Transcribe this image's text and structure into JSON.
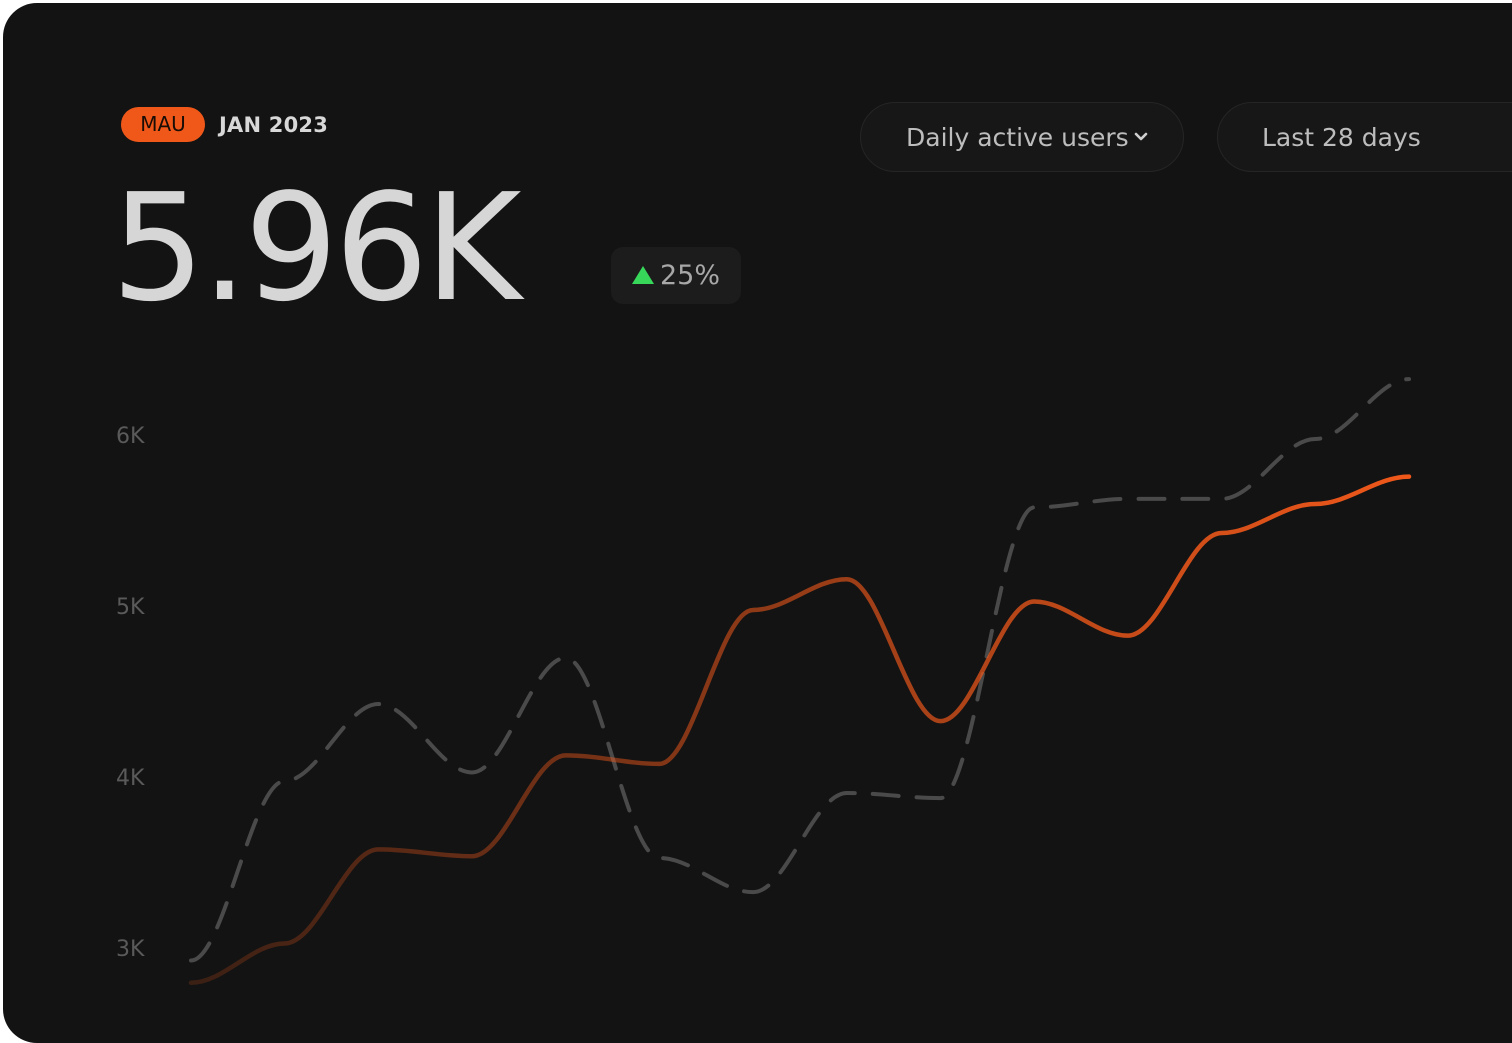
{
  "header": {
    "badge": "MAU",
    "period": "JAN 2023",
    "value": "5.96K",
    "delta": "25%"
  },
  "controls": {
    "metric_label": "Daily active users",
    "range_label": "Last 28 days"
  },
  "colors": {
    "accent": "#f0581a",
    "positive": "#37d85a",
    "background": "#131313"
  },
  "chart_data": {
    "type": "line",
    "title": "",
    "xlabel": "",
    "ylabel": "",
    "ylim": [
      2850,
      6400
    ],
    "yticks": [
      3000,
      4000,
      5000,
      6000
    ],
    "ytick_labels": [
      "3K",
      "4K",
      "5K",
      "6K"
    ],
    "grid": true,
    "x": [
      1,
      3,
      5,
      7,
      9,
      11,
      13,
      15,
      17,
      19,
      21,
      23,
      25,
      27
    ],
    "series": [
      {
        "style": "solid",
        "color": "#f0581a",
        "values": [
          2820,
          3050,
          3600,
          3560,
          4150,
          4100,
          5000,
          5180,
          4350,
          5050,
          4850,
          5450,
          5620,
          5780
        ]
      },
      {
        "style": "dashed",
        "color": "#4a4a4a",
        "values": [
          2950,
          4000,
          4450,
          4050,
          4720,
          3550,
          3350,
          3930,
          3900,
          5600,
          5650,
          5650,
          6000,
          6350
        ]
      }
    ]
  }
}
